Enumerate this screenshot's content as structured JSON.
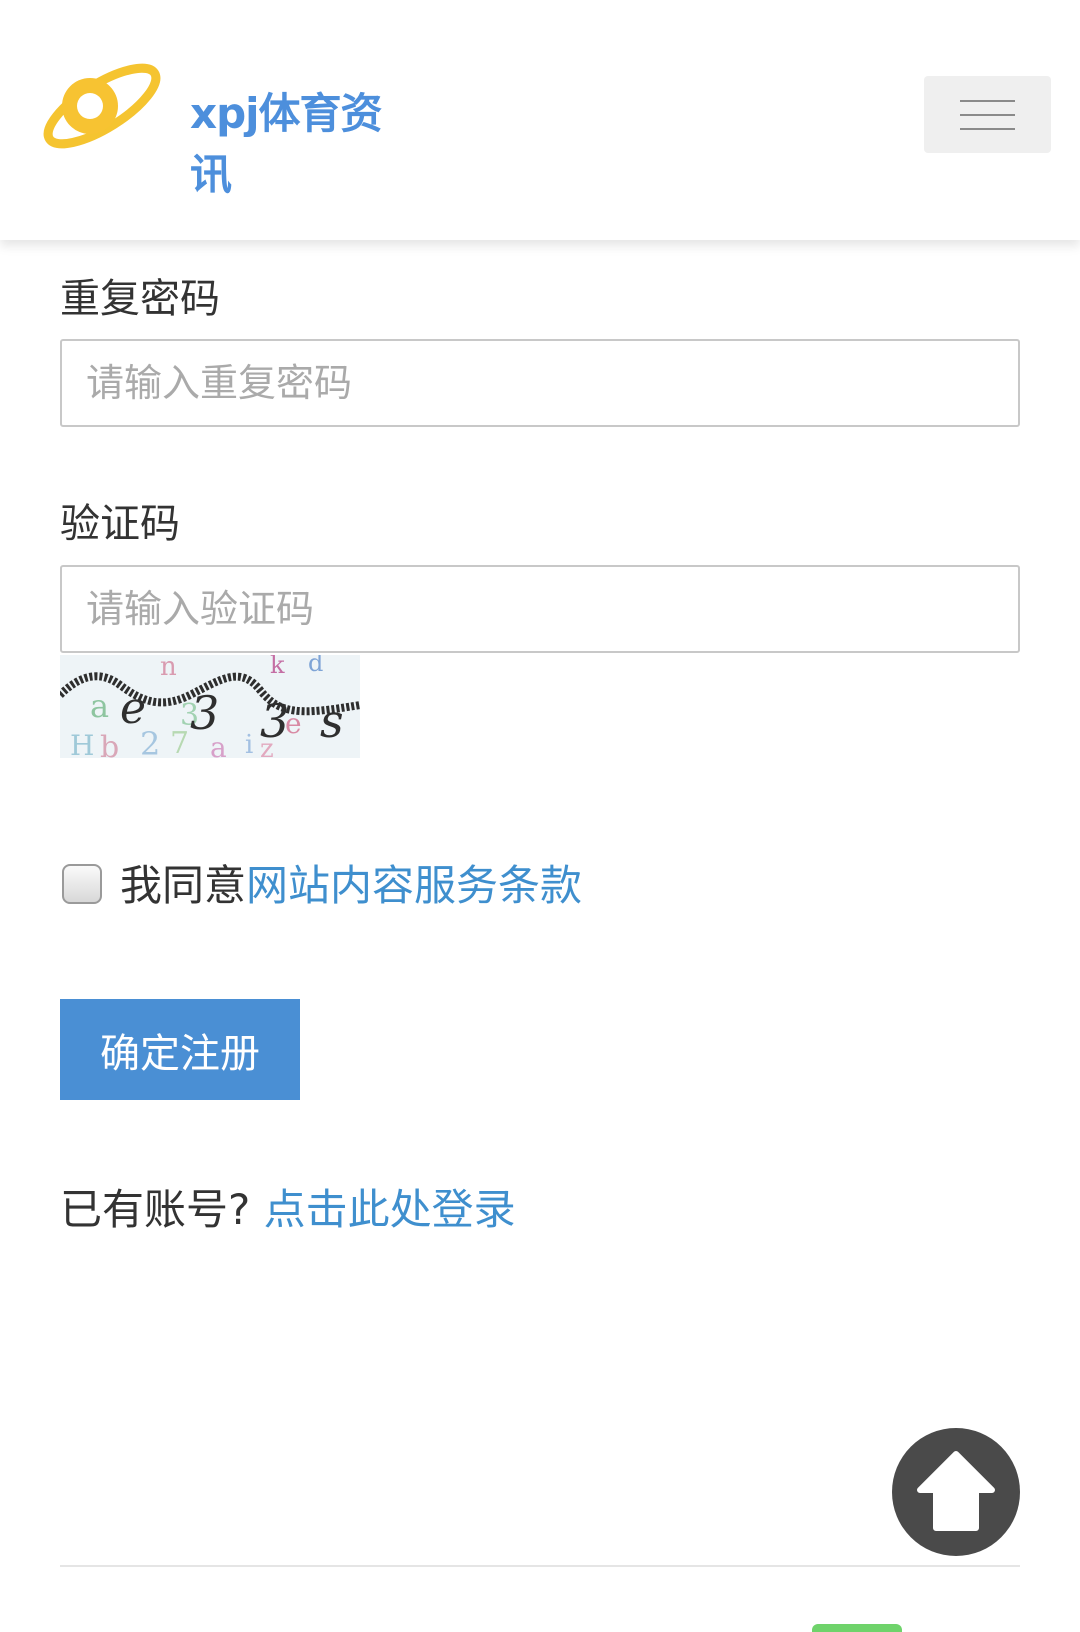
{
  "header": {
    "logo_text": "xpj体育资讯",
    "menu_icon": "hamburger-menu-icon"
  },
  "form": {
    "repeat_password": {
      "label": "重复密码",
      "placeholder": "请输入重复密码",
      "value": ""
    },
    "captcha_field": {
      "label": "验证码",
      "placeholder": "请输入验证码",
      "value": ""
    },
    "captcha_image_text": "nkd3e3sH27aiz",
    "agree": {
      "checked": false,
      "prefix": "我同意",
      "terms_link": "网站内容服务条款"
    },
    "submit_label": "确定注册"
  },
  "login_prompt": {
    "text": "已有账号?",
    "link": "点击此处登录"
  },
  "back_to_top_icon": "arrow-up-circle-icon",
  "colors": {
    "link": "#3f8fce",
    "button": "#4a8fd4",
    "logo_blue": "#4d8fdc",
    "logo_yellow": "#f7c332",
    "back_to_top": "#4a4a4a"
  }
}
